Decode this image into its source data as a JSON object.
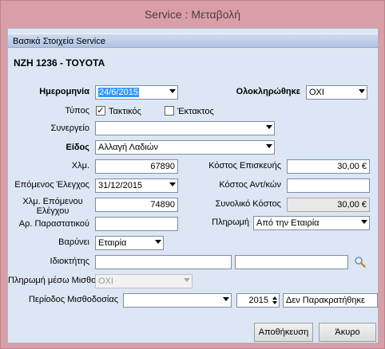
{
  "window": {
    "title": "Service : Μεταβολή"
  },
  "group": {
    "title": "Βασικά Στοιχεία Service"
  },
  "vehicle": {
    "caption": "ΝΖΗ 1236 -  TOYOTA"
  },
  "form": {
    "date": {
      "label": "Ημερομηνία",
      "value": "24/6/2015"
    },
    "completed": {
      "label": "Ολοκληρώθηκε",
      "value": "ΟΧΙ"
    },
    "type": {
      "label": "Τύπος",
      "option1": "Τακτικός",
      "option1_checked": true,
      "option2": "Έκτακτος",
      "option2_checked": false
    },
    "garage": {
      "label": "Συνεργείο",
      "value": ""
    },
    "kind": {
      "label": "Είδος",
      "value": "Αλλαγή Λαδιών"
    },
    "km": {
      "label": "Χλμ.",
      "value": "67890"
    },
    "repair_cost": {
      "label": "Κόστος Επισκευής",
      "value": "30,00 €"
    },
    "next_check": {
      "label": "Επόμενος Έλεγχος",
      "value": "31/12/2015"
    },
    "parts_cost": {
      "label": "Κόστος Αντ/κών",
      "value": ""
    },
    "next_km": {
      "label": "Χλμ. Επόμενου Ελέγχου",
      "value": "74890"
    },
    "total_cost": {
      "label": "Συνολικό Κόστος",
      "value": "30,00 €"
    },
    "receipt": {
      "label": "Αρ. Παραστατικού",
      "value": ""
    },
    "payment": {
      "label": "Πληρωμή",
      "value": "Από την Εταιρία"
    },
    "charged": {
      "label": "Βαρύνει",
      "value": "Εταιρία"
    },
    "owner": {
      "label": "Ιδιοκτήτης",
      "value1": "",
      "value2": ""
    },
    "salary_pay": {
      "label": "Πληρωμή μέσω Μισθοδ.",
      "value": "ΟΧΙ"
    },
    "payroll": {
      "label": "Περίοδος Μισθοδοσίας",
      "period": "",
      "year": "2015",
      "status": "Δεν Παρακρατήθηκε"
    }
  },
  "buttons": {
    "save": "Αποθήκευση",
    "cancel": "Άκυρο"
  },
  "icons": {
    "search": "search-icon"
  }
}
